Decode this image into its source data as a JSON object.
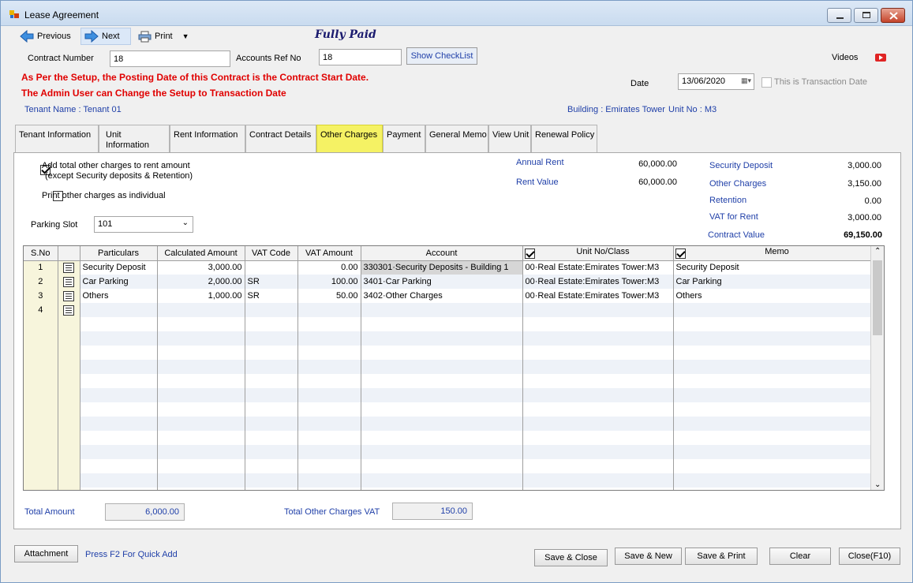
{
  "window": {
    "title": "Lease Agreement"
  },
  "toolbar": {
    "previous": "Previous",
    "next": "Next",
    "print": "Print",
    "status": "Fully Paid"
  },
  "form": {
    "contract_number_label": "Contract Number",
    "contract_number": "18",
    "accounts_ref_label": "Accounts Ref No",
    "accounts_ref": "18",
    "show_checklist": "Show CheckList",
    "videos": "Videos",
    "date_label": "Date",
    "date_value": "13/06/2020",
    "transaction_date_label": "This is Transaction Date",
    "warning_line1": "As Per the Setup, the Posting Date of this Contract is the Contract Start Date.",
    "warning_line2": "The Admin User can Change the Setup to Transaction Date",
    "tenant_name": "Tenant Name : Tenant 01",
    "building": "Building : Emirates Tower",
    "unit_no": "Unit No : M3"
  },
  "tabs": [
    {
      "label": "Tenant Information"
    },
    {
      "label": "Unit Information"
    },
    {
      "label": "Rent Information"
    },
    {
      "label": "Contract Details"
    },
    {
      "label": "Other Charges"
    },
    {
      "label": "Payment"
    },
    {
      "label": "General Memo"
    },
    {
      "label": "View Unit"
    },
    {
      "label": "Renewal Policy"
    }
  ],
  "options": {
    "add_total_line1": "Add total other charges to rent amount",
    "add_total_line2": "(except Security deposits  & Retention)",
    "print_individual": "Print other charges as individual",
    "parking_slot_label": "Parking Slot",
    "parking_slot_value": "101"
  },
  "summary": {
    "annual_rent_label": "Annual Rent",
    "annual_rent": "60,000.00",
    "rent_value_label": "Rent Value",
    "rent_value": "60,000.00",
    "security_deposit_label": "Security Deposit",
    "security_deposit": "3,000.00",
    "other_charges_label": "Other Charges",
    "other_charges": "3,150.00",
    "retention_label": "Retention",
    "retention": "0.00",
    "vat_for_rent_label": "VAT for Rent",
    "vat_for_rent": "3,000.00",
    "contract_value_label": "Contract Value",
    "contract_value": "69,150.00"
  },
  "grid": {
    "headers": {
      "sno": "S.No",
      "particulars": "Particulars",
      "calc_amount": "Calculated Amount",
      "vat_code": "VAT Code",
      "vat_amount": "VAT Amount",
      "account": "Account",
      "unit_class": "Unit No/Class",
      "memo": "Memo"
    },
    "rows": [
      {
        "sno": "1",
        "particulars": "Security Deposit",
        "calc_amount": "3,000.00",
        "vat_code": "",
        "vat_amount": "0.00",
        "account": "330301·Security Deposits - Building 1",
        "unit_class": "00·Real Estate:Emirates Tower:M3",
        "memo": "Security Deposit"
      },
      {
        "sno": "2",
        "particulars": "Car Parking",
        "calc_amount": "2,000.00",
        "vat_code": "SR",
        "vat_amount": "100.00",
        "account": "3401·Car Parking",
        "unit_class": "00·Real Estate:Emirates Tower:M3",
        "memo": "Car Parking"
      },
      {
        "sno": "3",
        "particulars": "Others",
        "calc_amount": "1,000.00",
        "vat_code": "SR",
        "vat_amount": "50.00",
        "account": "3402·Other Charges",
        "unit_class": "00·Real Estate:Emirates Tower:M3",
        "memo": "Others"
      },
      {
        "sno": "4",
        "particulars": "",
        "calc_amount": "",
        "vat_code": "",
        "vat_amount": "",
        "account": "",
        "unit_class": "",
        "memo": ""
      }
    ]
  },
  "totals": {
    "total_amount_label": "Total Amount",
    "total_amount": "6,000.00",
    "total_vat_label": "Total Other Charges VAT",
    "total_vat": "150.00"
  },
  "footer": {
    "attachment": "Attachment",
    "quick_add": "Press F2 For Quick Add",
    "save_close": "Save & Close",
    "save_new": "Save & New",
    "save_print": "Save & Print",
    "clear": "Clear",
    "close": "Close(F10)"
  }
}
